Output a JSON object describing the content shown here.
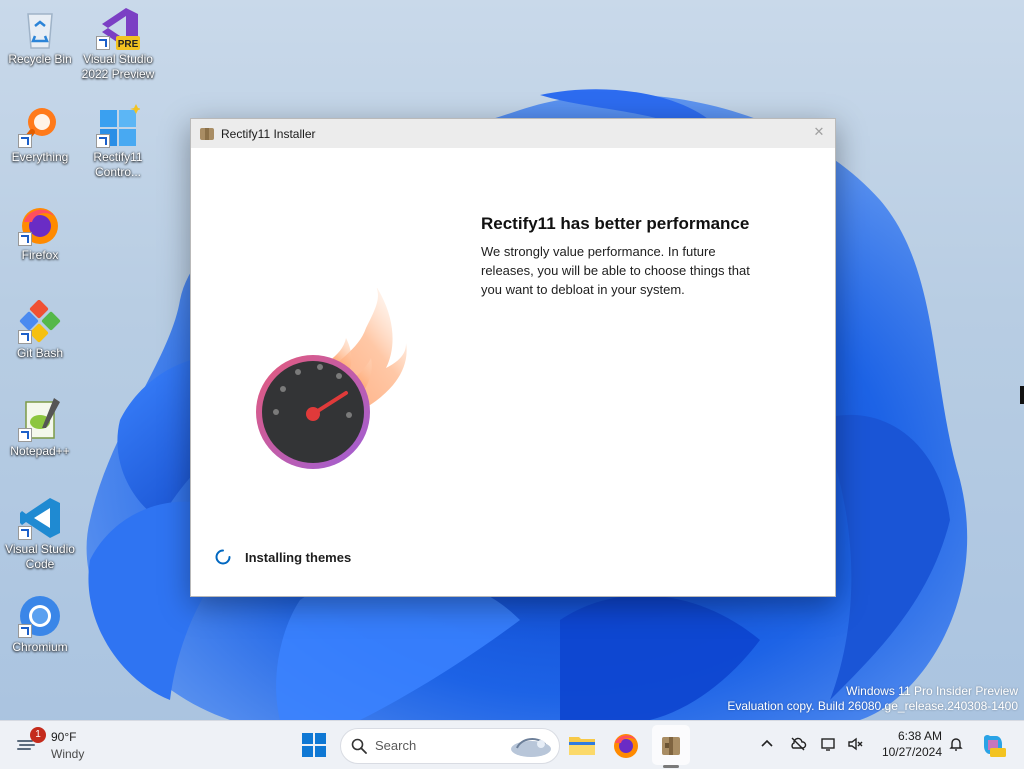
{
  "desktop": {
    "icons": [
      {
        "name": "recycle-bin",
        "label": "Recycle Bin"
      },
      {
        "name": "visual-studio-2022-preview",
        "label": "Visual Studio 2022 Preview",
        "badge": "PRE"
      },
      {
        "name": "everything",
        "label": "Everything"
      },
      {
        "name": "rectify11-control",
        "label": "Rectify11 Contro..."
      },
      {
        "name": "firefox",
        "label": "Firefox"
      },
      {
        "name": "git-bash",
        "label": "Git Bash"
      },
      {
        "name": "notepad-plus-plus",
        "label": "Notepad++"
      },
      {
        "name": "visual-studio-code",
        "label": "Visual Studio Code"
      },
      {
        "name": "chromium",
        "label": "Chromium"
      }
    ]
  },
  "window": {
    "title": "Rectify11 Installer",
    "close_glyph": "✕",
    "headline": "Rectify11 has better performance",
    "description": "We strongly value performance. In future releases, you will be able to choose things that you want to debloat in your system.",
    "status": "Installing themes",
    "illustration": "flaming-speedometer"
  },
  "watermark": {
    "line1": "Windows 11 Pro Insider Preview",
    "line2": "Evaluation copy. Build 26080.ge_release.240308-1400"
  },
  "taskbar": {
    "weather": {
      "badge": "1",
      "temp": "90°F",
      "condition": "Windy"
    },
    "search_placeholder": "Search",
    "apps": [
      "start-icon",
      "search",
      "file-explorer-icon",
      "firefox-icon",
      "installer-icon"
    ],
    "clock": {
      "time": "6:38 AM",
      "date": "10/27/2024"
    }
  },
  "colors": {
    "wallpaper_blue": "#1f5fe0",
    "taskbar_bg": "#eef1f6",
    "accent": "#0067c0"
  }
}
